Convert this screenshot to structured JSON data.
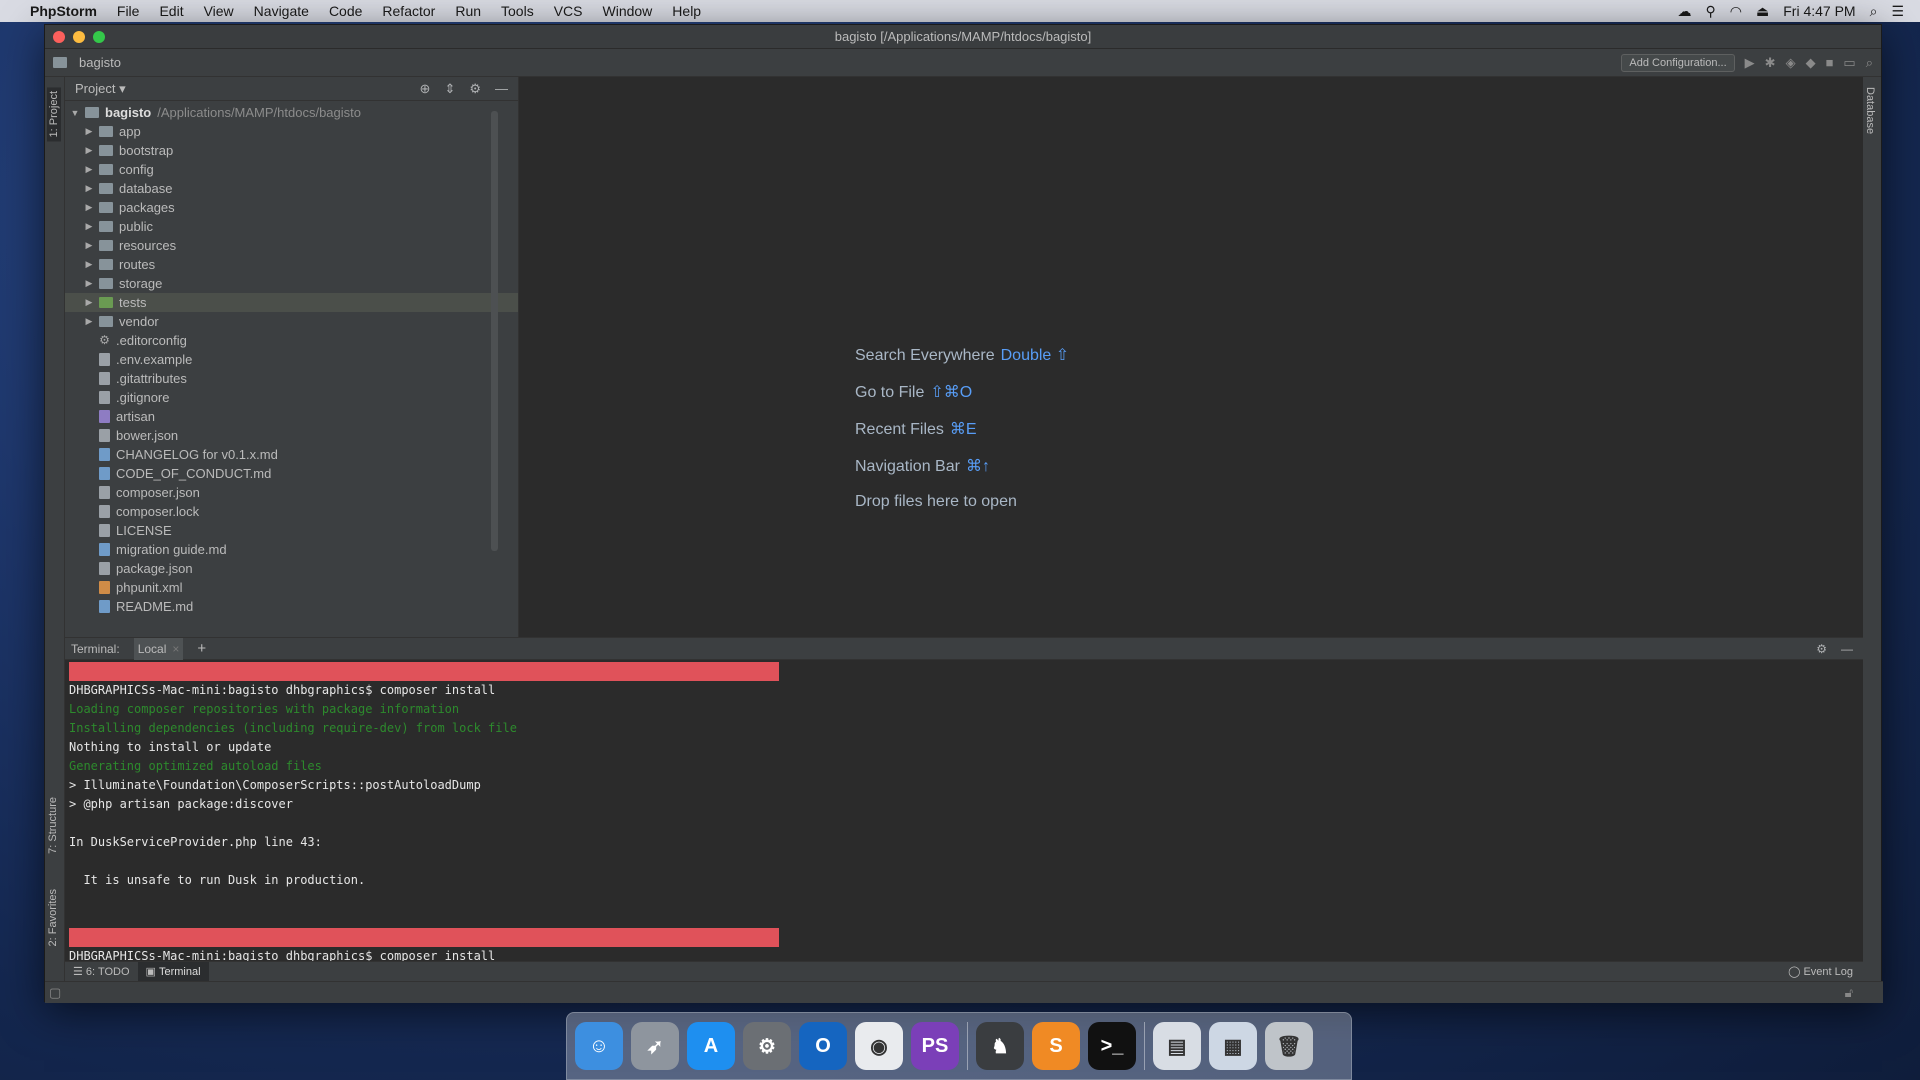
{
  "menubar": {
    "app": "PhpStorm",
    "items": [
      "File",
      "Edit",
      "View",
      "Navigate",
      "Code",
      "Refactor",
      "Run",
      "Tools",
      "VCS",
      "Window",
      "Help"
    ],
    "clock": "Fri 4:47 PM"
  },
  "window": {
    "title": "bagisto [/Applications/MAMP/htdocs/bagisto]",
    "breadcrumb": "bagisto",
    "add_config": "Add Configuration..."
  },
  "stripes": {
    "project": "1: Project",
    "structure": "7: Structure",
    "favorites": "2: Favorites",
    "database": "Database"
  },
  "project": {
    "header": "Project",
    "root": {
      "name": "bagisto",
      "path": "/Applications/MAMP/htdocs/bagisto"
    },
    "folders": [
      "app",
      "bootstrap",
      "config",
      "database",
      "packages",
      "public",
      "resources",
      "routes",
      "storage",
      "tests",
      "vendor"
    ],
    "selected": "tests",
    "files": [
      {
        "name": ".editorconfig",
        "kind": "cfg"
      },
      {
        "name": ".env.example",
        "kind": "txt"
      },
      {
        "name": ".gitattributes",
        "kind": "txt"
      },
      {
        "name": ".gitignore",
        "kind": "txt"
      },
      {
        "name": "artisan",
        "kind": "php"
      },
      {
        "name": "bower.json",
        "kind": "txt"
      },
      {
        "name": "CHANGELOG for v0.1.x.md",
        "kind": "md"
      },
      {
        "name": "CODE_OF_CONDUCT.md",
        "kind": "md"
      },
      {
        "name": "composer.json",
        "kind": "txt"
      },
      {
        "name": "composer.lock",
        "kind": "txt"
      },
      {
        "name": "LICENSE",
        "kind": "txt"
      },
      {
        "name": "migration guide.md",
        "kind": "md"
      },
      {
        "name": "package.json",
        "kind": "txt"
      },
      {
        "name": "phpunit.xml",
        "kind": "xml"
      },
      {
        "name": "README.md",
        "kind": "md"
      }
    ]
  },
  "editor_hints": [
    {
      "label": "Search Everywhere",
      "key": "Double ⇧"
    },
    {
      "label": "Go to File",
      "key": "⇧⌘O"
    },
    {
      "label": "Recent Files",
      "key": "⌘E"
    },
    {
      "label": "Navigation Bar",
      "key": "⌘↑"
    },
    {
      "label": "Drop files here to open",
      "key": ""
    }
  ],
  "terminal": {
    "label": "Terminal:",
    "tab": "Local",
    "lines": [
      {
        "text": "",
        "style": "err"
      },
      {
        "text": "DHBGRAPHICSs-Mac-mini:bagisto dhbgraphics$ composer install",
        "style": "white"
      },
      {
        "text": "Loading composer repositories with package information",
        "style": "green"
      },
      {
        "text": "Installing dependencies (including require-dev) from lock file",
        "style": "green"
      },
      {
        "text": "Nothing to install or update",
        "style": "white"
      },
      {
        "text": "Generating optimized autoload files",
        "style": "green"
      },
      {
        "text": "> Illuminate\\Foundation\\ComposerScripts::postAutoloadDump",
        "style": "white"
      },
      {
        "text": "> @php artisan package:discover",
        "style": "white"
      },
      {
        "text": "",
        "style": "white"
      },
      {
        "text": "In DuskServiceProvider.php line 43:",
        "style": "white"
      },
      {
        "text": "",
        "style": "white"
      },
      {
        "text": "  It is unsafe to run Dusk in production.",
        "style": "white"
      },
      {
        "text": "",
        "style": "white"
      },
      {
        "text": "",
        "style": "white"
      },
      {
        "text": "",
        "style": "err"
      },
      {
        "text": "DHBGRAPHICSs-Mac-mini:bagisto dhbgraphics$ composer install",
        "style": "white"
      }
    ]
  },
  "bottom_tools": {
    "todo": "6: TODO",
    "terminal": "Terminal",
    "event_log": "Event Log"
  },
  "dock": [
    {
      "name": "finder",
      "color": "#3d8fe0",
      "glyph": "☺"
    },
    {
      "name": "launchpad",
      "color": "#8e959e",
      "glyph": "➶"
    },
    {
      "name": "app-store",
      "color": "#1e8ff0",
      "glyph": "A"
    },
    {
      "name": "system-preferences",
      "color": "#6b6f74",
      "glyph": "⚙"
    },
    {
      "name": "outlook",
      "color": "#1565c0",
      "glyph": "O"
    },
    {
      "name": "chrome",
      "color": "#e9ebee",
      "glyph": "◉"
    },
    {
      "name": "phpstorm",
      "color": "#7b3fb8",
      "glyph": "PS"
    },
    {
      "name": "sequel-pro",
      "color": "#3a3d40",
      "glyph": "♞"
    },
    {
      "name": "sublime-text",
      "color": "#f08a24",
      "glyph": "S"
    },
    {
      "name": "terminal",
      "color": "#111111",
      "glyph": ">_"
    },
    {
      "name": "downloads-stack",
      "color": "#d8dde4",
      "glyph": "▤"
    },
    {
      "name": "documents-stack",
      "color": "#cdd7e4",
      "glyph": "▦"
    },
    {
      "name": "trash",
      "color": "#bfc4c9",
      "glyph": "🗑"
    }
  ]
}
